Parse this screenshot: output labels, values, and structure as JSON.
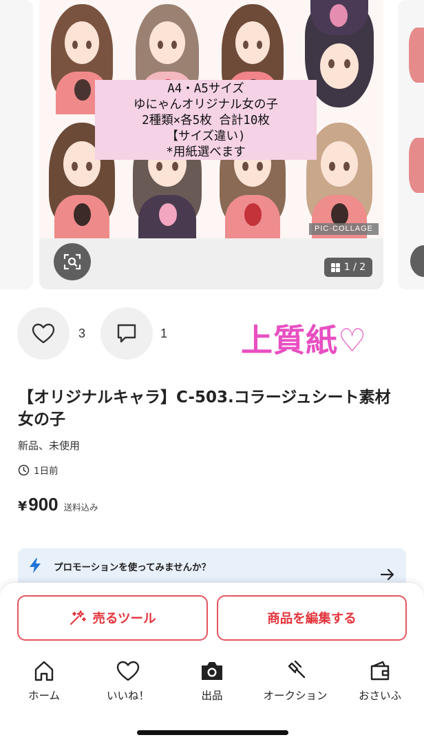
{
  "image": {
    "overlay_lines": [
      "A4・A5サイズ",
      "ゆにゃんオリジナル女の子",
      "2種類×各5枚 合計10枚",
      "【サイズ違い)",
      "*用紙選べます"
    ],
    "watermark": "PIC·COLLAGE",
    "page_indicator": "1 / 2"
  },
  "actions": {
    "like_count": "3",
    "comment_count": "1",
    "paper_label": "上質紙♡"
  },
  "item": {
    "title": "【オリジナルキャラ】C-503.コラージュシート素材　女の子",
    "condition": "新品、未使用",
    "posted": "1日前",
    "price_symbol": "¥",
    "price": "900",
    "shipping": "送料込み"
  },
  "promo": {
    "text": "プロモーションを使ってみませんか？"
  },
  "buttons": {
    "sell_tools": "売るツール",
    "edit_item": "商品を編集する"
  },
  "tabs": [
    {
      "label": "ホーム",
      "icon": "home-icon"
    },
    {
      "label": "いいね！",
      "icon": "heart-icon"
    },
    {
      "label": "出品",
      "icon": "camera-icon"
    },
    {
      "label": "オークション",
      "icon": "gavel-icon"
    },
    {
      "label": "おさいふ",
      "icon": "wallet-icon"
    }
  ],
  "colors": {
    "accent_red": "#e3353d",
    "paper_label_pink": "#e84fc2",
    "overlay_bg": "#f5d2e6",
    "promo_bg": "#e8f0fa"
  }
}
